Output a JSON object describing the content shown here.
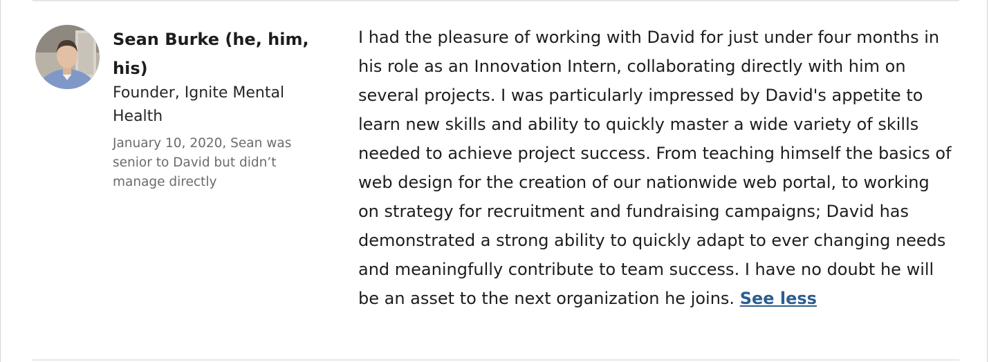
{
  "recommendation": {
    "recommender": {
      "name": "Sean Burke (he, him, his)",
      "headline": "Founder, Ignite Mental Health",
      "meta": "January 10, 2020, Sean was senior to David but didn’t manage directly",
      "avatar_icon": "profile-photo"
    },
    "text": "I had the pleasure of working with David for just under four months in his role as an Innovation Intern, collaborating directly with him on several projects. I was particularly impressed by David's appetite to learn new skills and ability to quickly master a wide variety of skills needed to achieve project success. From teaching himself the basics of web design for the creation of our nationwide web portal, to working on strategy for recruitment and fundraising campaigns; David has demonstrated a strong ability to quickly adapt to ever changing needs and meaningfully contribute to team success. I have no doubt he will be an asset to the next organization he joins.",
    "toggle_label": "See less",
    "colors": {
      "link": "#2d5e8e",
      "divider": "#e6e6e6"
    }
  }
}
